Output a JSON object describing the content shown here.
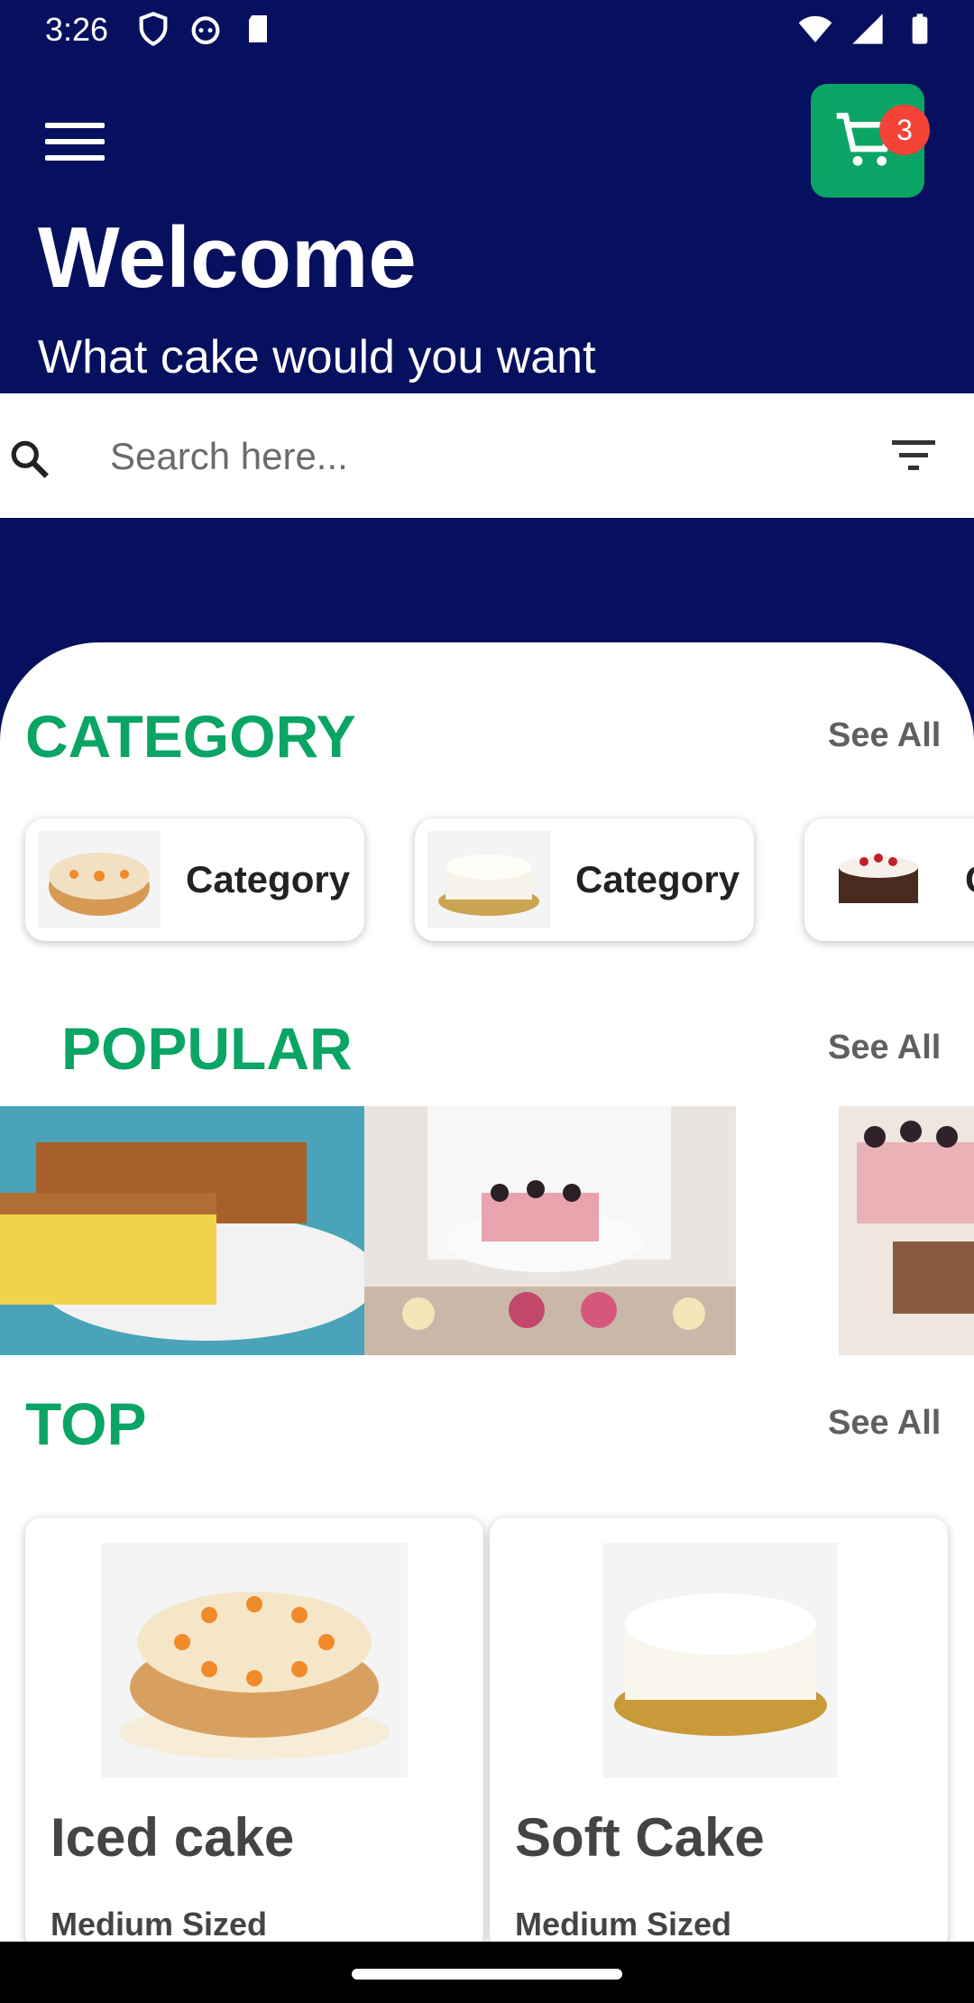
{
  "status": {
    "time": "3:26"
  },
  "header": {
    "title": "Welcome",
    "subtitle": "What cake would you want",
    "cart_count": "3"
  },
  "search": {
    "placeholder": "Search here..."
  },
  "category": {
    "title": "CATEGORY",
    "see_all": "See All",
    "items": [
      {
        "label": "Category"
      },
      {
        "label": "Category"
      },
      {
        "label": "C"
      }
    ]
  },
  "popular": {
    "title": "POPULAR",
    "see_all": "See All"
  },
  "top": {
    "title": "TOP",
    "see_all": "See All",
    "items": [
      {
        "name": "Iced cake",
        "size": "Medium Sized"
      },
      {
        "name": "Soft Cake",
        "size": "Medium Sized"
      }
    ]
  },
  "colors": {
    "primary": "#07105e",
    "accent": "#0aa564",
    "badge": "#f44336"
  }
}
